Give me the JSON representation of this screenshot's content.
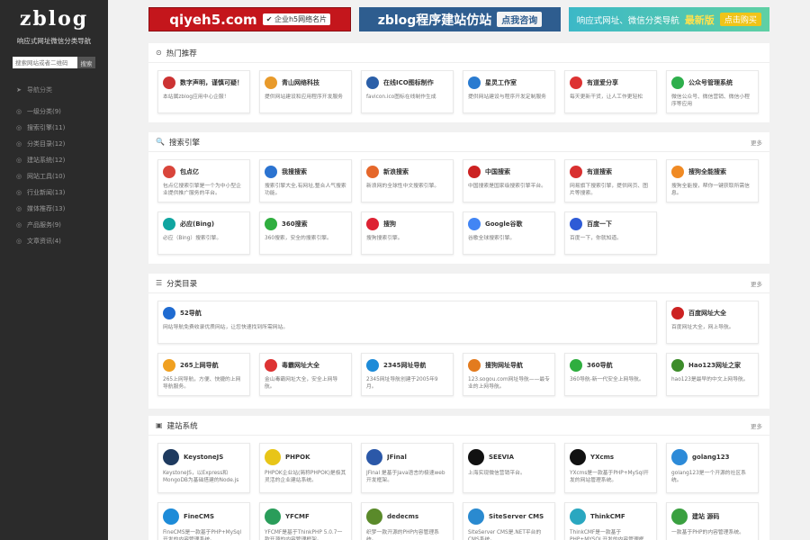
{
  "sidebar": {
    "logo": "zblog",
    "tagline": "响应式网址微信分类导航",
    "search_placeholder": "搜索网站或者二维码",
    "search_button": "搜索",
    "items": [
      {
        "label": "导航分类",
        "icon": "➤"
      },
      {
        "label": "一级分类(9)",
        "icon": "◎"
      },
      {
        "label": "搜索引擎(11)",
        "icon": "◎"
      },
      {
        "label": "分类目录(12)",
        "icon": "◎"
      },
      {
        "label": "建站系统(12)",
        "icon": "◎"
      },
      {
        "label": "网站工具(10)",
        "icon": "◎"
      },
      {
        "label": "行业新闻(13)",
        "icon": "◎"
      },
      {
        "label": "媒体推荐(13)",
        "icon": "◎"
      },
      {
        "label": "产品服务(9)",
        "icon": "◎"
      },
      {
        "label": "文章资讯(4)",
        "icon": "◎"
      }
    ]
  },
  "banners": [
    {
      "main": "qiyeh5.com",
      "tag": "✔ 企业h5网络名片",
      "color": "#c4161c"
    },
    {
      "main": "zblog程序建站仿站",
      "tag": "点我咨询",
      "color": "#2e5d8f"
    },
    {
      "main": "响应式网址、微信分类导航",
      "highlight": "最新版",
      "tag": "点击购买",
      "color": "#3cb8c7"
    }
  ],
  "sections": [
    {
      "title": "热门推荐",
      "icon": "⊙",
      "more": "",
      "items": [
        {
          "title": "数字声明，谨慎可疑！",
          "desc": "本站属zblog应用中心企服！",
          "color": "#c33"
        },
        {
          "title": "青山网络科技",
          "desc": "提供网站建设和应用程序开发服务",
          "color": "#e89a2b"
        },
        {
          "title": "在线ICO图标制作",
          "desc": "favicon.ico图标在线制作生成",
          "color": "#2b5fa8"
        },
        {
          "title": "星灵工作室",
          "desc": "提供网站建设与程序开发定制服务",
          "color": "#2a7bd0"
        },
        {
          "title": "有道爱分享",
          "desc": "每天更新干货，让人工作更轻松",
          "color": "#d33"
        },
        {
          "title": "公众号管理系统",
          "desc": "微信公众号、微信营销、微信小程序等应用",
          "color": "#2eaf4c"
        }
      ]
    },
    {
      "title": "搜索引擎",
      "icon": "🔍",
      "more": "更多",
      "items": [
        {
          "title": "包点亿",
          "desc": "包点亿搜索引擎是一个为中小型企业提供推广服务的平台。",
          "color": "#d9453b"
        },
        {
          "title": "我搜搜索",
          "desc": "搜索引擎大全,有网址,整合人气搜索功能。",
          "color": "#2b73d0"
        },
        {
          "title": "新浪搜索",
          "desc": "新浪网的全球性中文搜索引擎。",
          "color": "#e5672b"
        },
        {
          "title": "中国搜索",
          "desc": "中国搜索是国家级搜索引擎平台。",
          "color": "#c22"
        },
        {
          "title": "有道搜索",
          "desc": "网易旗下搜索引擎，提供网页、图片等搜索。",
          "color": "#d93030"
        },
        {
          "title": "搜狗全能搜索",
          "desc": "搜狗全能搜，帮你一键获取所需信息。",
          "color": "#f08a24"
        },
        {
          "title": "必应(Bing)",
          "desc": "必应（Bing）搜索引擎。",
          "color": "#10a5a0"
        },
        {
          "title": "360搜索",
          "desc": "360搜索，安全的搜索引擎。",
          "color": "#2fae3f"
        },
        {
          "title": "搜狗",
          "desc": "搜狗搜索引擎。",
          "color": "#d23"
        },
        {
          "title": "Google谷歌",
          "desc": "谷歌全球搜索引擎。",
          "color": "#4285f4"
        },
        {
          "title": "百度一下",
          "desc": "百度一下，你就知道。",
          "color": "#2e5bd6"
        }
      ]
    },
    {
      "title": "分类目录",
      "icon": "☰",
      "more": "更多",
      "items": [
        {
          "title": "52导航",
          "desc": "网站导航免费收录优质网站，让您快速找到所需网站。",
          "color": "#1f6bd1",
          "wide": true
        },
        {
          "title": "百度网址大全",
          "desc": "百度网址大全，网上导航。",
          "color": "#c22"
        },
        {
          "title": "265上网导航",
          "desc": "265上网导航，方便、快捷的上网导航服务。",
          "color": "#f0a020"
        },
        {
          "title": "毒霸网址大全",
          "desc": "金山毒霸网址大全，安全上网导航。",
          "color": "#d33"
        },
        {
          "title": "2345网址导航",
          "desc": "2345网址导航创建于2005年9月。",
          "color": "#1d8bd8"
        },
        {
          "title": "搜狗网址导航",
          "desc": "123.sogou.com网址导航——最专业的上网导航。",
          "color": "#e37b1e"
        },
        {
          "title": "360导航",
          "desc": "360导航-新一代安全上网导航。",
          "color": "#2fae3f"
        },
        {
          "title": "Hao123网址之家",
          "desc": "hao123是最早的中文上网导航。",
          "color": "#3d8c2a"
        }
      ]
    },
    {
      "title": "建站系统",
      "icon": "▣",
      "more": "更多",
      "items": [
        {
          "title": "KeystoneJS",
          "desc": "KeystoneJS，以Express和MongoDB为基础搭建的Node.js CMS。",
          "color": "#1e3a5f"
        },
        {
          "title": "PHPOK",
          "desc": "PHPOK企业站(简称PHPOK)是极其灵活的企业建站系统。",
          "color": "#e8c518"
        },
        {
          "title": "JFinal",
          "desc": "JFinal 是基于Java语言的极速web开发框架。",
          "color": "#2b58a8"
        },
        {
          "title": "SEEVIA",
          "desc": "上海实现微信营销平台。",
          "color": "#111"
        },
        {
          "title": "YXcms",
          "desc": "YXcms是一款基于PHP+MySql开发的网站管理系统。",
          "color": "#111"
        },
        {
          "title": "golang123",
          "desc": "golang123是一个开源的社区系统。",
          "color": "#2c8ad8"
        },
        {
          "title": "FineCMS",
          "desc": "FineCMS是一款基于PHP+MySql开发的内容管理系统。",
          "color": "#1d8bd8"
        },
        {
          "title": "YFCMF",
          "desc": "YFCMF是基于ThinkPHP 5.0.7一款开源的内容管理框架。",
          "color": "#2a9d5a"
        },
        {
          "title": "dedecms",
          "desc": "织梦一款开源的PHP内容管理系统。",
          "color": "#5a8a2a"
        },
        {
          "title": "SiteServer CMS",
          "desc": "SiteServer CMS是.NET平台的CMS系统。",
          "color": "#2a8ad0"
        },
        {
          "title": "ThinkCMF",
          "desc": "ThinkCMF是一款基于PHP+MYSQL开发的内容管理框架。",
          "color": "#2aa7c0"
        },
        {
          "title": "建站 源码",
          "desc": "一款基于PHP的内容管理系统。",
          "color": "#3aa040"
        }
      ]
    }
  ]
}
